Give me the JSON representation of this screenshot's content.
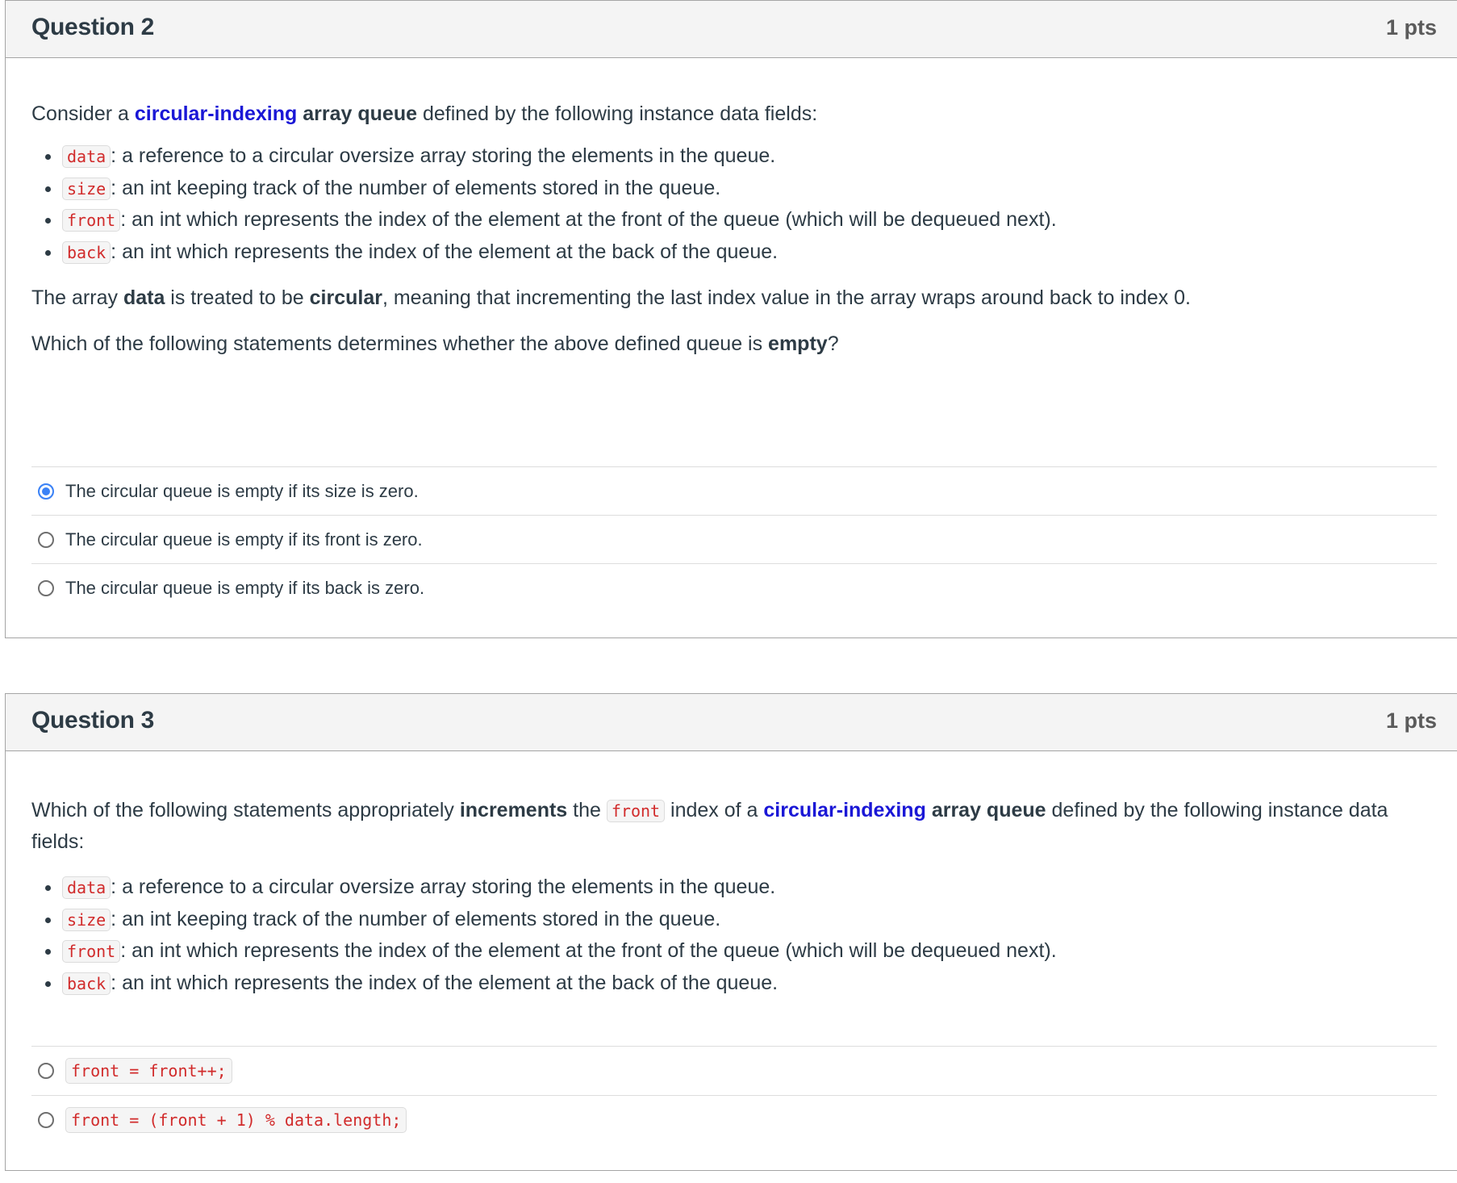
{
  "questions": [
    {
      "title": "Question 2",
      "points": "1 pts",
      "intro": {
        "p1": "Consider a ",
        "highlight": "circular-indexing",
        "p2": " ",
        "bold": "array queue",
        "p3": " defined by the following instance data fields:"
      },
      "fields": [
        {
          "code": "data",
          "text": ": a reference to a circular oversize array storing the elements in the queue."
        },
        {
          "code": "size",
          "text": ": an int keeping track of the number of elements stored in the queue."
        },
        {
          "code": "front",
          "text": ": an int which represents the index of the element at the front of the queue (which will be dequeued next)."
        },
        {
          "code": "back",
          "text": ": an int which represents the index of the element at the back of the queue."
        }
      ],
      "para2": {
        "t1": "The array ",
        "b1": "data",
        "t2": " is treated to be ",
        "b2": "circular",
        "t3": ", meaning that incrementing the last index value in the array wraps around back to index 0."
      },
      "prompt": {
        "t1": "Which of the following statements determines whether the above defined queue is ",
        "b1": "empty",
        "t2": "?"
      },
      "answers": [
        {
          "label": "The circular queue is empty if its size is zero.",
          "selected": true
        },
        {
          "label": "The circular queue is empty if its front is zero.",
          "selected": false
        },
        {
          "label": "The circular queue is empty if its back is zero.",
          "selected": false
        }
      ]
    },
    {
      "title": "Question 3",
      "points": "1 pts",
      "prompt": {
        "t1": "Which of the following statements appropriately ",
        "b1": "increments",
        "t2": " the ",
        "code": "front",
        "t3": " index of a ",
        "highlight": "circular-indexing",
        "t4": " ",
        "b2": "array queue",
        "t5": " defined by the following instance data fields:"
      },
      "fields": [
        {
          "code": "data",
          "text": ": a reference to a circular oversize array storing the elements in the queue."
        },
        {
          "code": "size",
          "text": ": an int keeping track of the number of elements stored in the queue."
        },
        {
          "code": "front",
          "text": ": an int which represents the index of the element at the front of the queue (which will be dequeued next)."
        },
        {
          "code": "back",
          "text": ": an int which represents the index of the element at the back of the queue."
        }
      ],
      "answers": [
        {
          "code": "front = front++;",
          "selected": false
        },
        {
          "code": "front = (front + 1) % data.length;",
          "selected": false
        }
      ]
    }
  ],
  "colors": {
    "highlight_blue": "#1a17d6",
    "code_red": "#d12b2b",
    "radio_selected": "#3b82f6",
    "header_bg": "#f4f4f4"
  }
}
